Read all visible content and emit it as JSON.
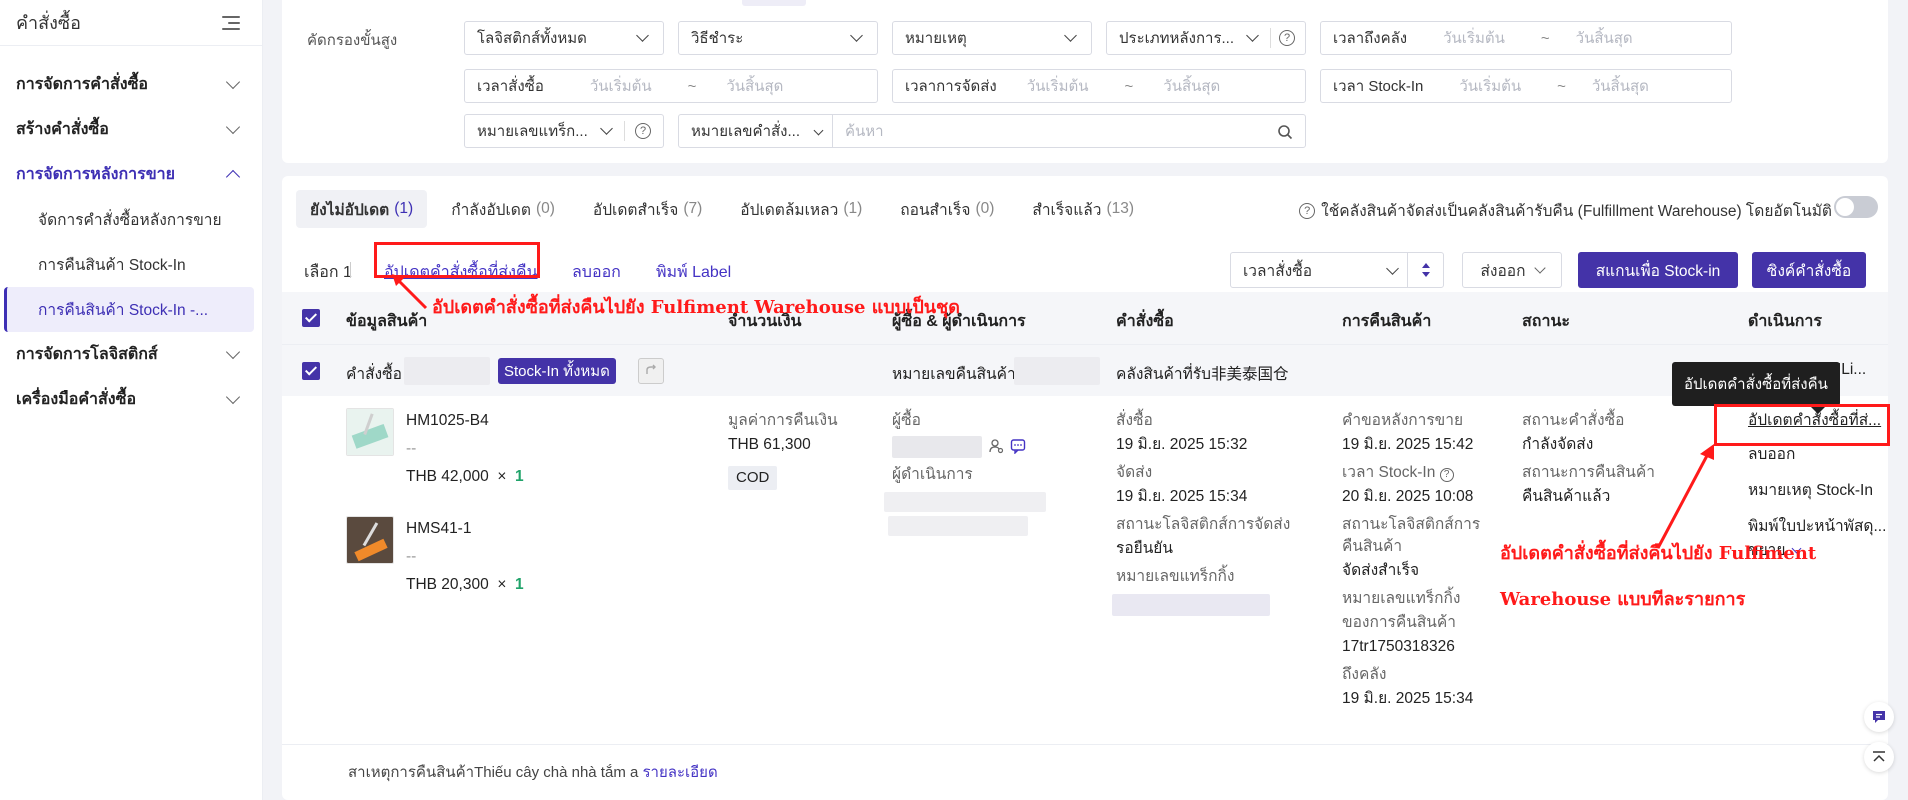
{
  "sidebar": {
    "title": "คำสั่งซื้อ",
    "groups": [
      {
        "label": "การจัดการคำสั่งซื้อ"
      },
      {
        "label": "สร้างคำสั่งซื้อ"
      },
      {
        "label": "การจัดการหลังการขาย"
      },
      {
        "label": "การจัดการโลจิสติกส์"
      },
      {
        "label": "เครื่องมือคำสั่งซื้อ"
      }
    ],
    "subitems": [
      {
        "label": "จัดการคำสั่งซื้อหลังการขาย"
      },
      {
        "label": "การคืนสินค้า Stock-In"
      },
      {
        "label": "การคืนสินค้า Stock-In -..."
      }
    ]
  },
  "filters": {
    "label": "คัดกรองขั้นสูง",
    "logistics": "โลจิสติกส์ทั้งหมด",
    "payment": "วิธีชำระ",
    "note": "หมายเหตุ",
    "after_sale_type": "ประเภทหลังการ...",
    "arrive_label": "เวลาถึงคลัง",
    "order_time_label": "เวลาสั่งซื้อ",
    "ship_time_label": "เวลาการจัดส่ง",
    "stockin_label": "เวลา Stock-In",
    "start_ph": "วันเริ่มต้น",
    "end_ph": "วันสิ้นสุด",
    "tilde": "~",
    "tracking": "หมายเลขแทร็ก...",
    "order_no": "หมายเลขคำสั่ง...",
    "search_ph": "ค้นหา"
  },
  "tabs": [
    {
      "label": "ยังไม่อัปเดต",
      "count": "(1)"
    },
    {
      "label": "กำลังอัปเดต",
      "count": "(0)"
    },
    {
      "label": "อัปเดตสำเร็จ",
      "count": "(7)"
    },
    {
      "label": "อัปเดตล้มเหลว",
      "count": "(1)"
    },
    {
      "label": "ถอนสำเร็จ",
      "count": "(0)"
    },
    {
      "label": "สำเร็จแล้ว",
      "count": "(13)"
    }
  ],
  "auto_warehouse": "ใช้คลังสินค้าจัดส่งเป็นคลังสินค้ารับคืน (Fulfillment Warehouse) โดยอัตโนมัติ",
  "actions": {
    "selected": "เลือก 1",
    "update_return": "อัปเดตคำสั่งซื้อที่ส่งคืน",
    "remove": "ลบออก",
    "print_label": "พิมพ์ Label",
    "sort_field": "เวลาสั่งซื้อ",
    "export": "ส่งออก",
    "scan_stockin": "สแกนเพื่อ Stock-in",
    "sync_orders": "ซิงค์คำสั่งซื้อ"
  },
  "table": {
    "headers": [
      "ข้อมูลสินค้า",
      "จำนวนเงิน",
      "ผู้ซื้อ & ผู้ดำเนินการ",
      "คำสั่งซื้อ",
      "การคืนสินค้า",
      "สถานะ",
      "ดำเนินการ"
    ]
  },
  "order": {
    "label": "คำสั่งซื้อ",
    "badge": "Stock-In ทั้งหมด",
    "return_no_label": "หมายเลขคืนสินค้า",
    "warehouse": "คลังสินค้าที่รับ非美泰国仓",
    "truncated_id": "NLi...",
    "products": [
      {
        "sku": "HM1025-B4",
        "dash": "--",
        "price": "THB 42,000",
        "x": "×",
        "qty": "1"
      },
      {
        "sku": "HMS41-1",
        "dash": "--",
        "price": "THB 20,300",
        "x": "×",
        "qty": "1"
      }
    ],
    "refund_label": "มูลค่าการคืนเงิน",
    "refund_amount": "THB 61,300",
    "payment": "COD",
    "buyer_label": "ผู้ซื้อ",
    "operator_label": "ผู้ดำเนินการ",
    "ordered_label": "สั่งซื้อ",
    "ordered_time": "19 มิ.ย. 2025 15:32",
    "shipped_label": "จัดส่ง",
    "shipped_time": "19 มิ.ย. 2025 15:34",
    "ship_status_label": "สถานะโลจิสติกส์การจัดส่ง",
    "ship_status": "รอยืนยัน",
    "tracking_label": "หมายเลขแทร็กกิ้ง",
    "req_label": "คำขอหลังการขาย",
    "req_time": "19 มิ.ย. 2025 15:42",
    "stockin_label": "เวลา Stock-In",
    "stockin_time": "20 มิ.ย. 2025 10:08",
    "return_logistics_label": "สถานะโลจิสติกส์การ",
    "return_logistics_label2": "คืนสินค้า",
    "return_logistics": "จัดส่งสำเร็จ",
    "return_tracking_label": "หมายเลขแทร็กกิ้ง",
    "return_tracking_label2": "ของการคืนสินค้า",
    "return_tracking": "17tr1750318326",
    "arrive_label": "ถึงคลัง",
    "arrive_time": "19 มิ.ย. 2025 15:34",
    "order_status_label": "สถานะคำสั่งซื้อ",
    "order_status": "กำลังจัดส่ง",
    "return_status_label": "สถานะการคืนสินค้า",
    "return_status": "คืนสินค้าแล้ว",
    "op_update": "อัปเดตคำสั่งซื้อที่ส่...",
    "op_remove": "ลบออก",
    "op_note": "หมายเหตุ Stock-In",
    "op_print": "พิมพ์ใบปะหน้าพัสดุ...",
    "op_expand": "ขยาย",
    "reason_label": "สาเหตุการคืนสินค้า",
    "reason": "Thiếu cây chà nhà tắm a",
    "reason_detail": "รายละเอียด"
  },
  "tooltip": "อัปเดตคำสั่งซื้อที่ส่งคืน",
  "annotations": {
    "batch": "อัปเดตคำสั่งซื้อที่ส่งคืนไปยัง Fulfiment Warehouse แบบเป็นชุด",
    "single_1": "อัปเดตคำสั่งซื้อที่ส่งคืนไปยัง Fulfiment",
    "single_2": "Warehouse แบบทีละรายการ"
  },
  "colors": {
    "accent": "#4433a8",
    "annotation": "#ff1a1a",
    "success": "#20a36a"
  }
}
